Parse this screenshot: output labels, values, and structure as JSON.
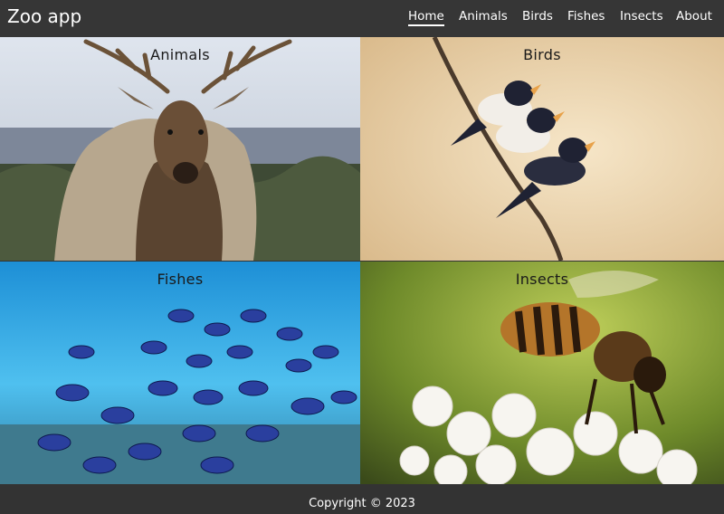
{
  "app": {
    "title": "Zoo app"
  },
  "nav": {
    "items": [
      {
        "label": "Home",
        "active": true
      },
      {
        "label": "Animals"
      },
      {
        "label": "Birds"
      },
      {
        "label": "Fishes"
      },
      {
        "label": "Insects"
      },
      {
        "label": "About"
      }
    ]
  },
  "gallery": {
    "tiles": [
      {
        "label": "Animals",
        "image": "elk-photo"
      },
      {
        "label": "Birds",
        "image": "swallows-on-branch-photo"
      },
      {
        "label": "Fishes",
        "image": "school-of-blue-fish-photo"
      },
      {
        "label": "Insects",
        "image": "bee-on-flower-photo"
      }
    ]
  },
  "footer": {
    "copyright": "Copyright © 2023"
  },
  "colors": {
    "navbar": "#363636",
    "footer": "#333333",
    "text": "#ffffff"
  }
}
